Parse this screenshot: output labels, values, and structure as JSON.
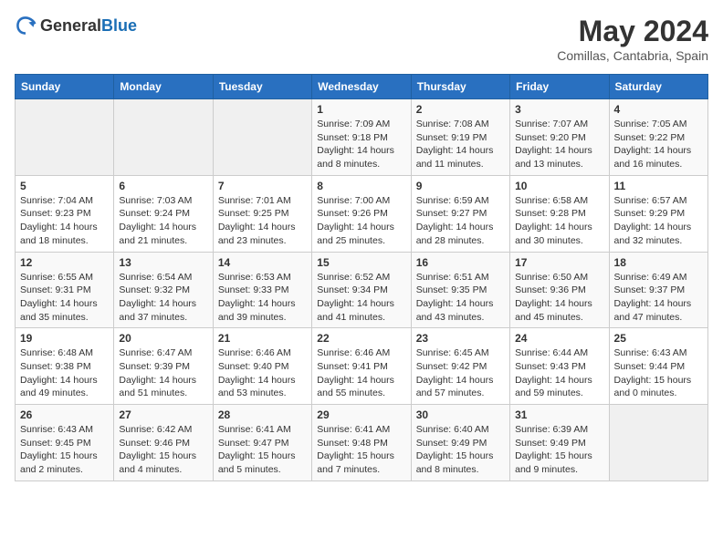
{
  "header": {
    "logo_general": "General",
    "logo_blue": "Blue",
    "title": "May 2024",
    "subtitle": "Comillas, Cantabria, Spain"
  },
  "calendar": {
    "days_of_week": [
      "Sunday",
      "Monday",
      "Tuesday",
      "Wednesday",
      "Thursday",
      "Friday",
      "Saturday"
    ],
    "weeks": [
      [
        {
          "day": "",
          "sunrise": "",
          "sunset": "",
          "daylight": ""
        },
        {
          "day": "",
          "sunrise": "",
          "sunset": "",
          "daylight": ""
        },
        {
          "day": "",
          "sunrise": "",
          "sunset": "",
          "daylight": ""
        },
        {
          "day": "1",
          "sunrise": "Sunrise: 7:09 AM",
          "sunset": "Sunset: 9:18 PM",
          "daylight": "Daylight: 14 hours and 8 minutes."
        },
        {
          "day": "2",
          "sunrise": "Sunrise: 7:08 AM",
          "sunset": "Sunset: 9:19 PM",
          "daylight": "Daylight: 14 hours and 11 minutes."
        },
        {
          "day": "3",
          "sunrise": "Sunrise: 7:07 AM",
          "sunset": "Sunset: 9:20 PM",
          "daylight": "Daylight: 14 hours and 13 minutes."
        },
        {
          "day": "4",
          "sunrise": "Sunrise: 7:05 AM",
          "sunset": "Sunset: 9:22 PM",
          "daylight": "Daylight: 14 hours and 16 minutes."
        }
      ],
      [
        {
          "day": "5",
          "sunrise": "Sunrise: 7:04 AM",
          "sunset": "Sunset: 9:23 PM",
          "daylight": "Daylight: 14 hours and 18 minutes."
        },
        {
          "day": "6",
          "sunrise": "Sunrise: 7:03 AM",
          "sunset": "Sunset: 9:24 PM",
          "daylight": "Daylight: 14 hours and 21 minutes."
        },
        {
          "day": "7",
          "sunrise": "Sunrise: 7:01 AM",
          "sunset": "Sunset: 9:25 PM",
          "daylight": "Daylight: 14 hours and 23 minutes."
        },
        {
          "day": "8",
          "sunrise": "Sunrise: 7:00 AM",
          "sunset": "Sunset: 9:26 PM",
          "daylight": "Daylight: 14 hours and 25 minutes."
        },
        {
          "day": "9",
          "sunrise": "Sunrise: 6:59 AM",
          "sunset": "Sunset: 9:27 PM",
          "daylight": "Daylight: 14 hours and 28 minutes."
        },
        {
          "day": "10",
          "sunrise": "Sunrise: 6:58 AM",
          "sunset": "Sunset: 9:28 PM",
          "daylight": "Daylight: 14 hours and 30 minutes."
        },
        {
          "day": "11",
          "sunrise": "Sunrise: 6:57 AM",
          "sunset": "Sunset: 9:29 PM",
          "daylight": "Daylight: 14 hours and 32 minutes."
        }
      ],
      [
        {
          "day": "12",
          "sunrise": "Sunrise: 6:55 AM",
          "sunset": "Sunset: 9:31 PM",
          "daylight": "Daylight: 14 hours and 35 minutes."
        },
        {
          "day": "13",
          "sunrise": "Sunrise: 6:54 AM",
          "sunset": "Sunset: 9:32 PM",
          "daylight": "Daylight: 14 hours and 37 minutes."
        },
        {
          "day": "14",
          "sunrise": "Sunrise: 6:53 AM",
          "sunset": "Sunset: 9:33 PM",
          "daylight": "Daylight: 14 hours and 39 minutes."
        },
        {
          "day": "15",
          "sunrise": "Sunrise: 6:52 AM",
          "sunset": "Sunset: 9:34 PM",
          "daylight": "Daylight: 14 hours and 41 minutes."
        },
        {
          "day": "16",
          "sunrise": "Sunrise: 6:51 AM",
          "sunset": "Sunset: 9:35 PM",
          "daylight": "Daylight: 14 hours and 43 minutes."
        },
        {
          "day": "17",
          "sunrise": "Sunrise: 6:50 AM",
          "sunset": "Sunset: 9:36 PM",
          "daylight": "Daylight: 14 hours and 45 minutes."
        },
        {
          "day": "18",
          "sunrise": "Sunrise: 6:49 AM",
          "sunset": "Sunset: 9:37 PM",
          "daylight": "Daylight: 14 hours and 47 minutes."
        }
      ],
      [
        {
          "day": "19",
          "sunrise": "Sunrise: 6:48 AM",
          "sunset": "Sunset: 9:38 PM",
          "daylight": "Daylight: 14 hours and 49 minutes."
        },
        {
          "day": "20",
          "sunrise": "Sunrise: 6:47 AM",
          "sunset": "Sunset: 9:39 PM",
          "daylight": "Daylight: 14 hours and 51 minutes."
        },
        {
          "day": "21",
          "sunrise": "Sunrise: 6:46 AM",
          "sunset": "Sunset: 9:40 PM",
          "daylight": "Daylight: 14 hours and 53 minutes."
        },
        {
          "day": "22",
          "sunrise": "Sunrise: 6:46 AM",
          "sunset": "Sunset: 9:41 PM",
          "daylight": "Daylight: 14 hours and 55 minutes."
        },
        {
          "day": "23",
          "sunrise": "Sunrise: 6:45 AM",
          "sunset": "Sunset: 9:42 PM",
          "daylight": "Daylight: 14 hours and 57 minutes."
        },
        {
          "day": "24",
          "sunrise": "Sunrise: 6:44 AM",
          "sunset": "Sunset: 9:43 PM",
          "daylight": "Daylight: 14 hours and 59 minutes."
        },
        {
          "day": "25",
          "sunrise": "Sunrise: 6:43 AM",
          "sunset": "Sunset: 9:44 PM",
          "daylight": "Daylight: 15 hours and 0 minutes."
        }
      ],
      [
        {
          "day": "26",
          "sunrise": "Sunrise: 6:43 AM",
          "sunset": "Sunset: 9:45 PM",
          "daylight": "Daylight: 15 hours and 2 minutes."
        },
        {
          "day": "27",
          "sunrise": "Sunrise: 6:42 AM",
          "sunset": "Sunset: 9:46 PM",
          "daylight": "Daylight: 15 hours and 4 minutes."
        },
        {
          "day": "28",
          "sunrise": "Sunrise: 6:41 AM",
          "sunset": "Sunset: 9:47 PM",
          "daylight": "Daylight: 15 hours and 5 minutes."
        },
        {
          "day": "29",
          "sunrise": "Sunrise: 6:41 AM",
          "sunset": "Sunset: 9:48 PM",
          "daylight": "Daylight: 15 hours and 7 minutes."
        },
        {
          "day": "30",
          "sunrise": "Sunrise: 6:40 AM",
          "sunset": "Sunset: 9:49 PM",
          "daylight": "Daylight: 15 hours and 8 minutes."
        },
        {
          "day": "31",
          "sunrise": "Sunrise: 6:39 AM",
          "sunset": "Sunset: 9:49 PM",
          "daylight": "Daylight: 15 hours and 9 minutes."
        },
        {
          "day": "",
          "sunrise": "",
          "sunset": "",
          "daylight": ""
        }
      ]
    ]
  }
}
